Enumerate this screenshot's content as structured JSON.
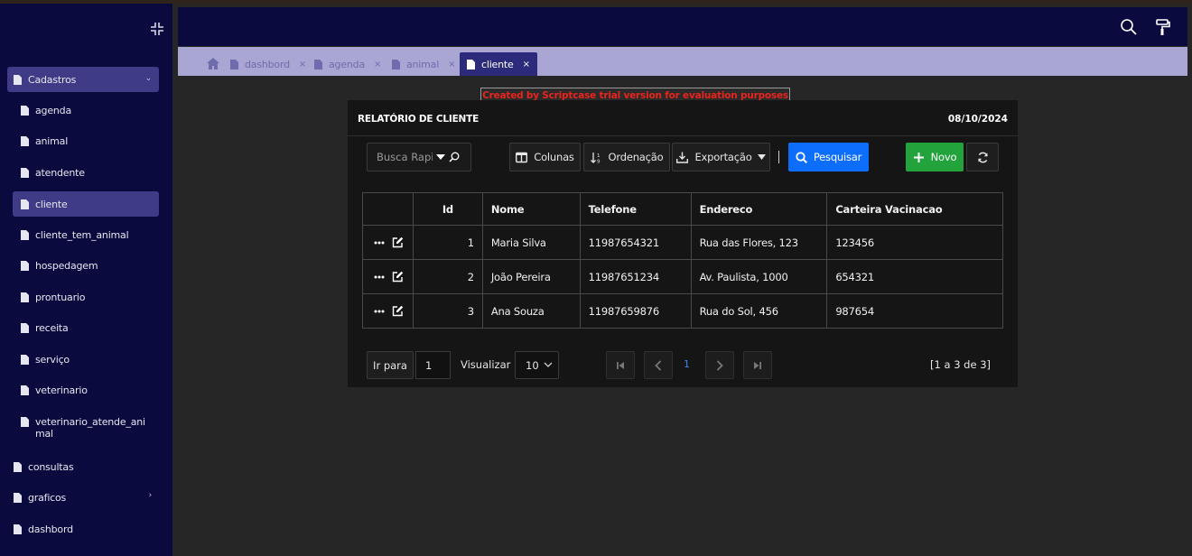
{
  "sidebar": {
    "menu": [
      {
        "label": "Cadastros",
        "expanded": true
      },
      {
        "label": "consultas"
      },
      {
        "label": "graficos",
        "has_children": true
      },
      {
        "label": "dashbord"
      }
    ],
    "cadastros_items": [
      {
        "label": "agenda"
      },
      {
        "label": "animal"
      },
      {
        "label": "atendente"
      },
      {
        "label": "cliente",
        "active": true
      },
      {
        "label": "cliente_tem_animal"
      },
      {
        "label": "hospedagem"
      },
      {
        "label": "prontuario"
      },
      {
        "label": "receita"
      },
      {
        "label": "serviço"
      },
      {
        "label": "veterinario"
      },
      {
        "label": "veterinario_atende_animal"
      }
    ]
  },
  "header": {
    "icons": [
      "search-icon",
      "paint-roller-icon"
    ]
  },
  "tabs": [
    {
      "label": "dashbord",
      "active": false
    },
    {
      "label": "agenda",
      "active": false
    },
    {
      "label": "animal",
      "active": false
    },
    {
      "label": "cliente",
      "active": true
    }
  ],
  "tab_close": "×",
  "trial_banner": "Created by Scriptcase trial version for evaluation purposes only.",
  "report": {
    "title": "RELATÓRIO DE CLIENTE",
    "date": "08/10/2024",
    "toolbar": {
      "search_placeholder": "Busca Rapida",
      "columns_label": "Colunas",
      "sort_label": "Ordenação",
      "export_label": "Exportação",
      "search_label": "Pesquisar",
      "new_label": "Novo"
    },
    "table": {
      "headers": [
        "",
        "Id",
        "Nome",
        "Telefone",
        "Endereco",
        "Carteira Vacinacao"
      ],
      "rows": [
        {
          "id": "1",
          "nome": "Maria Silva",
          "telefone": "11987654321",
          "endereco": "Rua das Flores, 123",
          "carteira": "123456"
        },
        {
          "id": "2",
          "nome": "João Pereira",
          "telefone": "11987651234",
          "endereco": "Av. Paulista, 1000",
          "carteira": "654321"
        },
        {
          "id": "3",
          "nome": "Ana Souza",
          "telefone": "11987659876",
          "endereco": "Rua do Sol, 456",
          "carteira": "987654"
        }
      ]
    },
    "pagination": {
      "goto_label": "Ir para",
      "goto_value": "1",
      "view_label": "Visualizar",
      "page_size": "10",
      "current_page": "1",
      "info": "[1 a 3 de 3]"
    }
  },
  "colors": {
    "sidebar_bg": "#0b0a3f",
    "active_item": "#3f3b86",
    "tabbar_bg": "#a9a6d3",
    "primary": "#0d6efd",
    "success": "#22a33c",
    "trial_text": "#e8241c"
  }
}
